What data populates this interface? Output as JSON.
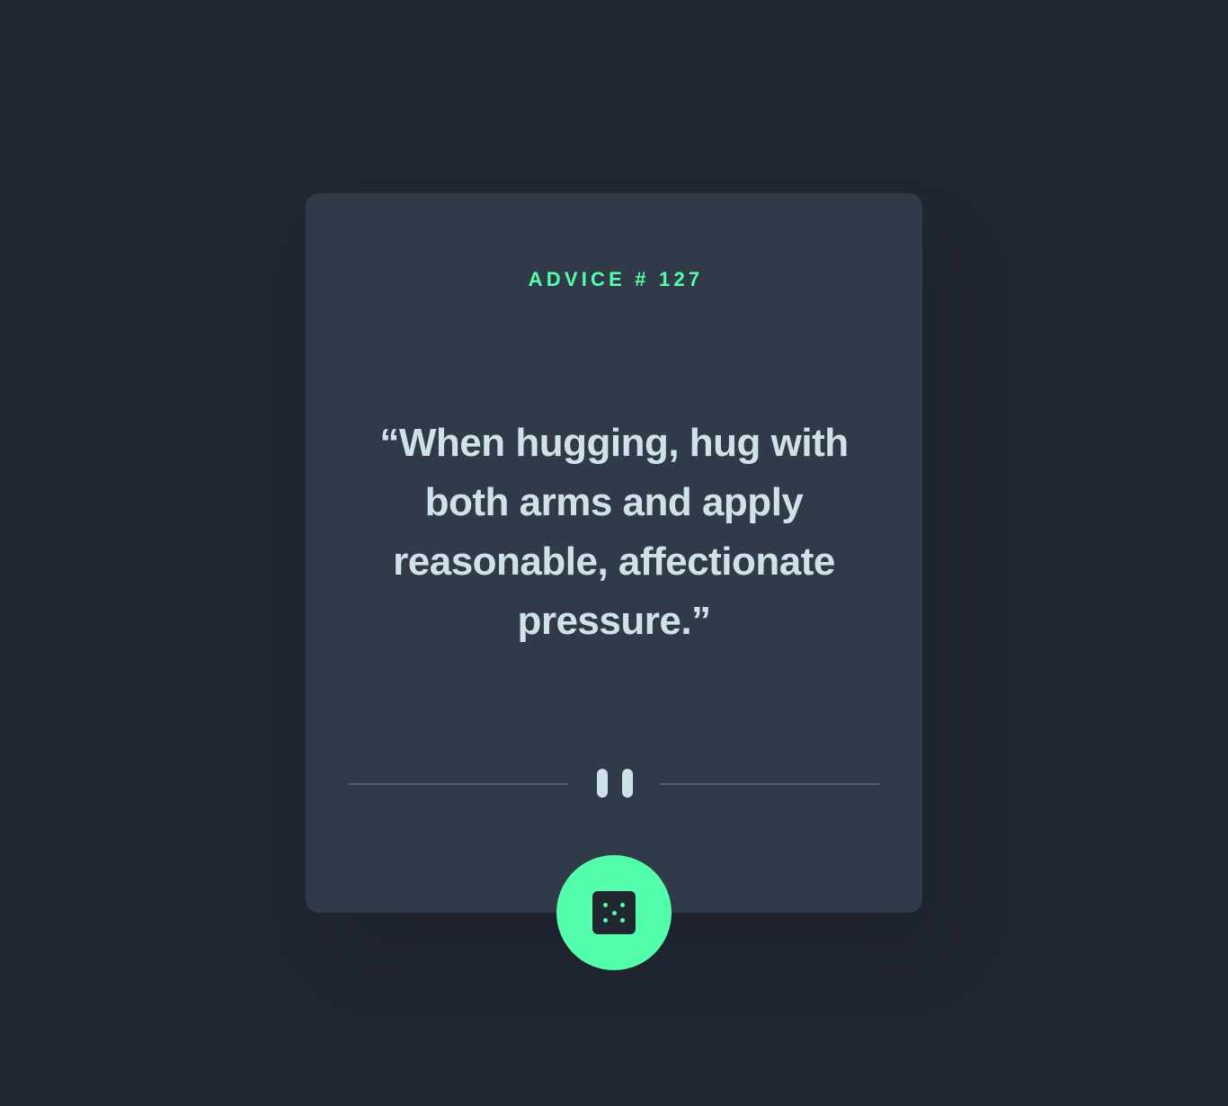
{
  "advice": {
    "id_label": "ADVICE # 127",
    "quote": "“When hugging, hug with both arms and apply reasonable, affectionate pressure.”"
  },
  "button": {
    "icon": "dice-icon",
    "aria_label": "Generate new advice"
  },
  "colors": {
    "background": "#202632",
    "card": "#313a48",
    "accent": "#53ffaa",
    "text": "#cee3e9",
    "divider": "#4f5d74"
  }
}
